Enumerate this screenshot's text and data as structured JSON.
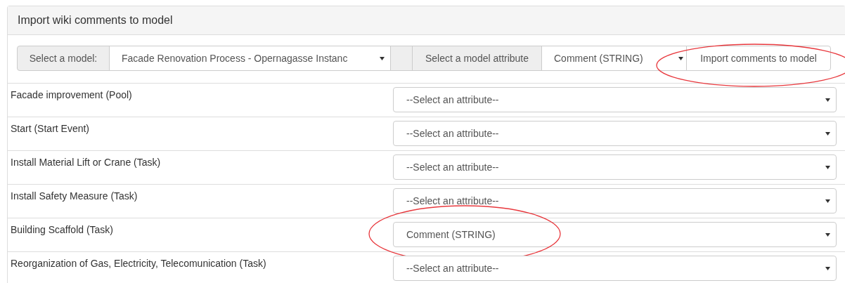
{
  "panel": {
    "title": "Import wiki comments to model"
  },
  "toolbar": {
    "model_label": "Select a model:",
    "model_value": "Facade Renovation Process - Opernagasse Instanc",
    "attribute_label": "Select a model attribute",
    "attribute_value": "Comment (STRING)",
    "import_button": {
      "label": "Import comments to model",
      "circled": true
    }
  },
  "rows": [
    {
      "label": "Facade improvement (Pool)",
      "value": "--Select an attribute--",
      "circled": false
    },
    {
      "label": "Start (Start Event)",
      "value": "--Select an attribute--",
      "circled": false
    },
    {
      "label": "Install Material Lift or Crane (Task)",
      "value": "--Select an attribute--",
      "circled": false
    },
    {
      "label": "Install Safety Measure (Task)",
      "value": "--Select an attribute--",
      "circled": false
    },
    {
      "label": "Building Scaffold (Task)",
      "value": "Comment (STRING)",
      "circled": true
    },
    {
      "label": "Reorganization of Gas, Electricity, Telecomunication (Task)",
      "value": "--Select an attribute--",
      "circled": false
    }
  ]
}
